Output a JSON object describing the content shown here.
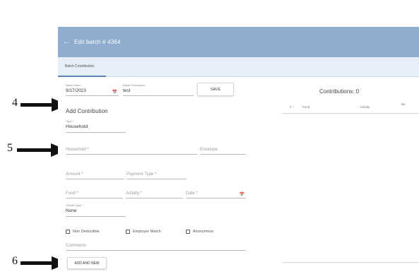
{
  "header": {
    "back_icon": "arrow-left-icon",
    "title": "Edit batch # 4364"
  },
  "tabs": [
    {
      "label": "Batch Contribution"
    }
  ],
  "batch": {
    "date_label": "Batch Date *",
    "date_value": "9/17/2023",
    "desc_label": "Batch Description",
    "desc_value": "test",
    "save_label": "SAVE"
  },
  "add_contribution": {
    "title": "Add Contribution",
    "type_label": "Type *",
    "type_value": "Household",
    "household_placeholder": "Household *",
    "envelope_placeholder": "Envelope",
    "amount_placeholder": "Amount *",
    "payment_type_placeholder": "Payment Type *",
    "fund_placeholder": "Fund *",
    "activity_placeholder": "Activity *",
    "date_placeholder": "Date *",
    "tribute_type_label": "Tribute Type *",
    "tribute_type_value": "None",
    "checkboxes": [
      "Non Deductible",
      "Employer Match",
      "Anonymous"
    ],
    "comments_placeholder": "Comments",
    "add_new_label": "ADD AND NEW"
  },
  "contributions": {
    "title": "Contributions: 0",
    "columns": [
      "#",
      "Fund",
      "Activity",
      "Be"
    ]
  },
  "annotations": [
    "4",
    "5",
    "6"
  ]
}
